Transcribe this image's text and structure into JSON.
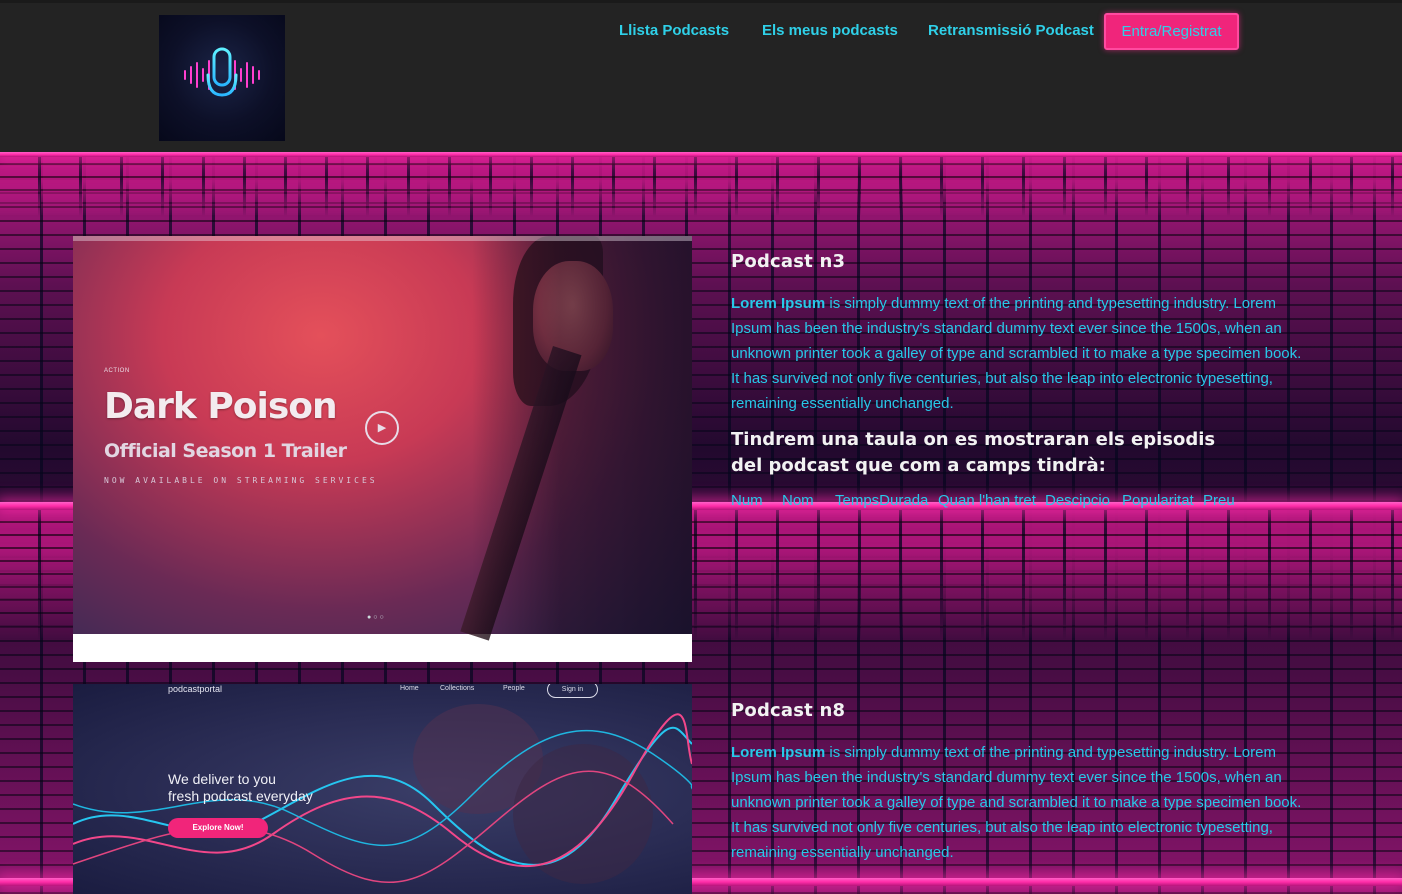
{
  "header": {
    "logo_icon": "microphone-soundwave-icon",
    "nav": [
      {
        "label": "Llista Podcasts"
      },
      {
        "label": "Els meus podcasts"
      },
      {
        "label": "Retransmissió Podcast"
      }
    ],
    "login_label": "Entra/Registrat"
  },
  "colors": {
    "accent_cyan": "#2fd0e8",
    "accent_pink": "#f0257b",
    "header_bg": "#232323"
  },
  "podcasts": [
    {
      "title": "Podcast n3",
      "desc_bold": "Lorem Ipsum",
      "desc_rest": " is simply dummy text of the printing and typesetting industry. Lorem Ipsum has been the industry's standard dummy text ever since the 1500s, when an unknown printer took a galley of type and scrambled it to make a type specimen book. It has survived not only five centuries, but also the leap into electronic typesetting, remaining essentially unchanged.",
      "table_intro": "Tindrem una taula on es mostraran els episodis del podcast que com a camps tindrà:",
      "table_columns": [
        "Num",
        "Nom",
        "TempsDurada",
        "Quan l'han tret",
        "Descipcio",
        "Popularitat",
        "Preu"
      ],
      "image": {
        "kicker": "ACTION",
        "title": "Dark Poison",
        "subtitle": "Official Season 1 Trailer",
        "tagline": "NOW AVAILABLE ON STREAMING SERVICES",
        "play_icon": "play-icon"
      }
    },
    {
      "title": "Podcast n8",
      "desc_bold": "Lorem Ipsum",
      "desc_rest": " is simply dummy text of the printing and typesetting industry. Lorem Ipsum has been the industry's standard dummy text ever since the 1500s, when an unknown printer took a galley of type and scrambled it to make a type specimen book. It has survived not only five centuries, but also the leap into electronic typesetting, remaining essentially unchanged.",
      "image": {
        "brand": "podcastportal",
        "menu": [
          "Home",
          "Collections",
          "People"
        ],
        "signin": "Sign in",
        "headline_1": "We deliver to you",
        "headline_2": "fresh podcast everyday",
        "cta": "Explore Now!"
      }
    }
  ]
}
